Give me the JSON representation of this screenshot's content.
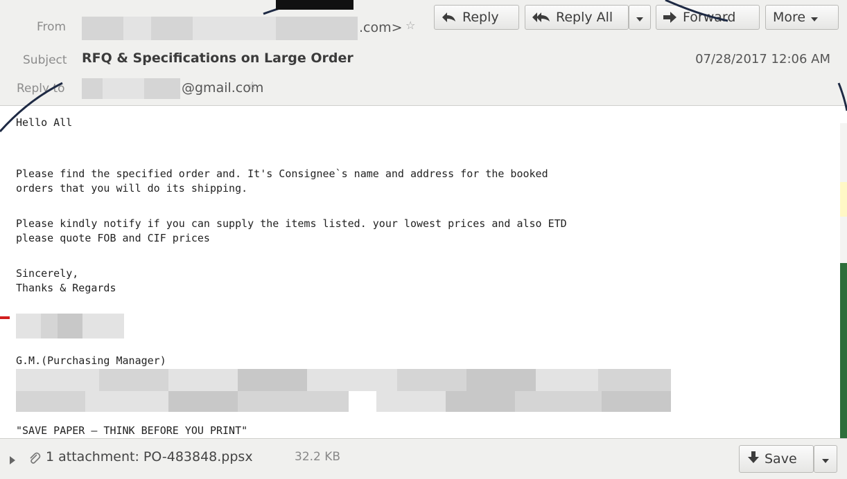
{
  "header": {
    "from_label": "From",
    "from_domain_suffix": ".com>",
    "subject_label": "Subject",
    "subject": "RFQ & Specifications on Large Order",
    "date": "07/28/2017 12:06 AM",
    "reply_to_label": "Reply to",
    "reply_to_suffix": "@gmail.com",
    "buttons": {
      "reply": "Reply",
      "reply_all": "Reply All",
      "forward": "Forward",
      "more": "More"
    }
  },
  "body": {
    "lines": [
      "Hello All",
      "Please find the specified order and. It's Consignee`s name and address for the booked",
      "orders that you will do its shipping.",
      "Please kindly notify if you can supply the items listed. your lowest prices and also ETD",
      "please quote FOB and CIF prices",
      "Sincerely,",
      "Thanks & Regards",
      "G.M.(Purchasing Manager)",
      "\"SAVE PAPER – THINK BEFORE YOU PRINT\""
    ]
  },
  "attachment": {
    "label": "1 attachment: PO-483848.ppsx",
    "size": "32.2 KB",
    "save_label": "Save"
  },
  "icons": {
    "star": "star-outline-icon",
    "reply": "reply-arrow-icon",
    "reply_all": "reply-all-arrow-icon",
    "forward": "forward-arrow-icon",
    "dropdown": "chevron-down-icon",
    "expand": "triangle-right-icon",
    "paperclip": "paperclip-icon",
    "save": "download-arrow-icon"
  }
}
